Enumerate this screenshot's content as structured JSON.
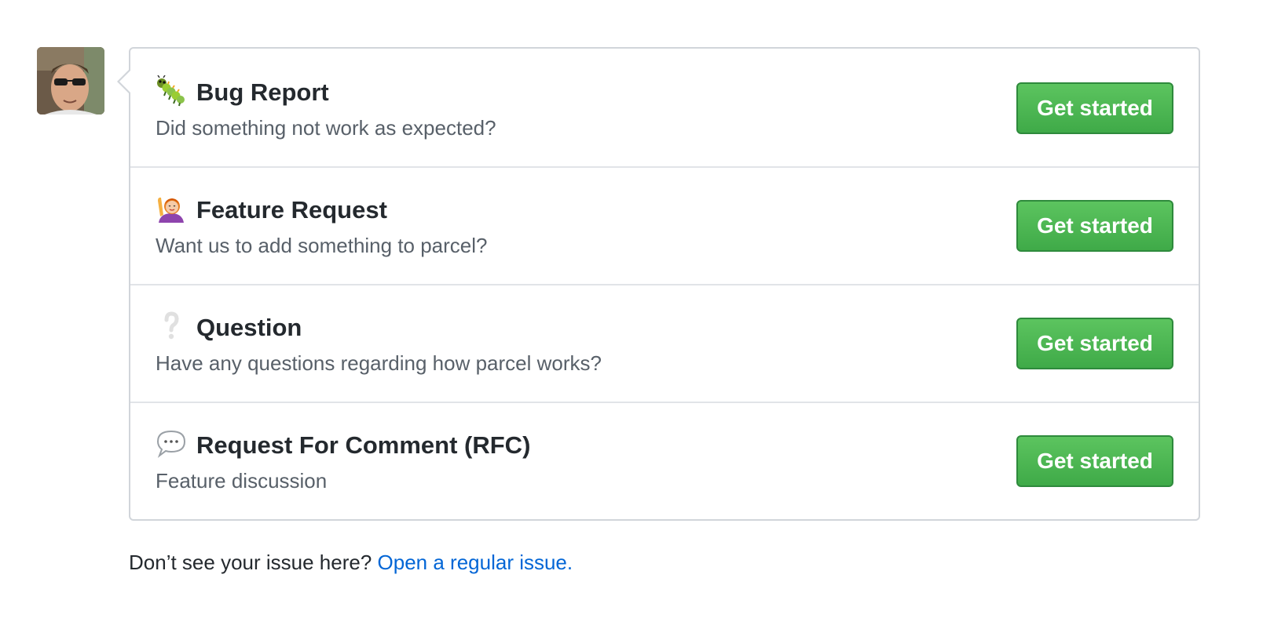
{
  "avatar": {
    "icon": "user-avatar"
  },
  "templates": [
    {
      "icon": "bug-icon",
      "title": "Bug Report",
      "description": "Did something not work as expected?",
      "button_label": "Get started"
    },
    {
      "icon": "raising-hand-icon",
      "title": "Feature Request",
      "description": "Want us to add something to parcel?",
      "button_label": "Get started"
    },
    {
      "icon": "question-mark-icon",
      "title": "Question",
      "description": "Have any questions regarding how parcel works?",
      "button_label": "Get started"
    },
    {
      "icon": "speech-balloon-icon",
      "title": "Request For Comment (RFC)",
      "description": "Feature discussion",
      "button_label": "Get started"
    }
  ],
  "footer": {
    "prompt": "Don’t see your issue here?",
    "link": "Open a regular issue."
  },
  "colors": {
    "button_green": "#3faa48",
    "link_blue": "#0366d6",
    "description_gray": "#586069",
    "border": "#d1d5da"
  }
}
